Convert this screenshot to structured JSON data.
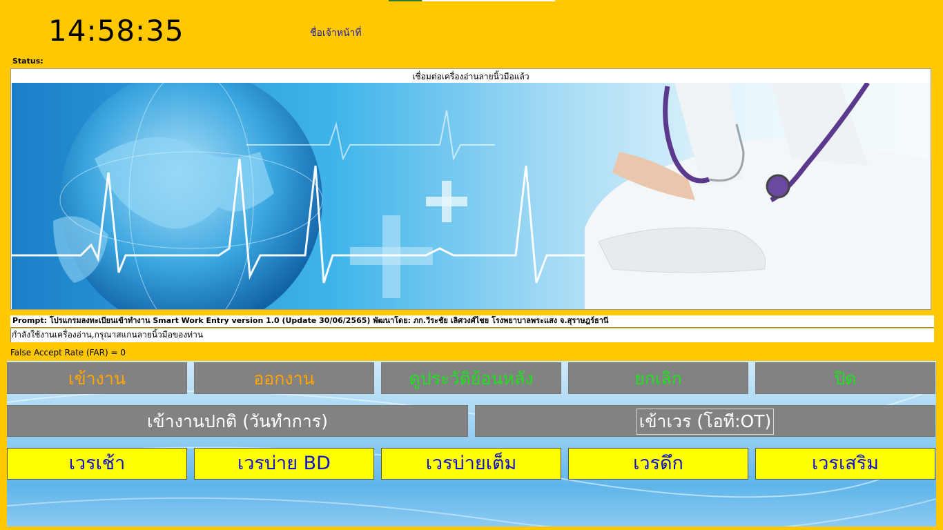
{
  "header": {
    "clock": "14:58:35",
    "officer_label": "ชื่อเจ้าหน้าที่"
  },
  "status": {
    "label": "Status:",
    "message": "เชื่อมต่อเครื่องอ่านลายนิ้วมือแล้ว"
  },
  "prompt": "Prompt: โปรแกรมลงทะเบียนเข้าทำงาน Smart Work Entry version 1.0 (Update 30/06/2565) พัฒนาโดย: ภก.วีระชัย เลิศวงศ์ไชย โรงพยาบาลพระแสง จ.สุราษฎร์ธานี",
  "instruction": "กำลังใช้งานเครื่องอ่าน,กรุณาสแกนลายนิ้วมือของท่าน",
  "far_text": "False Accept Rate (FAR) = 0",
  "buttons": {
    "checkin": "เข้างาน",
    "checkout": "ออกงาน",
    "history": "ดูประวัติย้อนหลัง",
    "cancel": "ยกเลิก",
    "close": "ปิด",
    "normal_work": "เข้างานปกติ (วันทำการ)",
    "ot_work": "เข้าเวร (โอที:OT)",
    "shift_morning": "เวรเช้า",
    "shift_afternoon_bd": "เวรบ่าย BD",
    "shift_afternoon_full": "เวรบ่ายเต็ม",
    "shift_night": "เวรดึก",
    "shift_extra": "เวรเสริม"
  },
  "colors": {
    "background": "#ffc800",
    "button_gray": "#828282",
    "button_yellow": "#ffff00",
    "text_orange": "#ffa500",
    "text_green": "#20e020",
    "text_blue": "#1010c8"
  }
}
